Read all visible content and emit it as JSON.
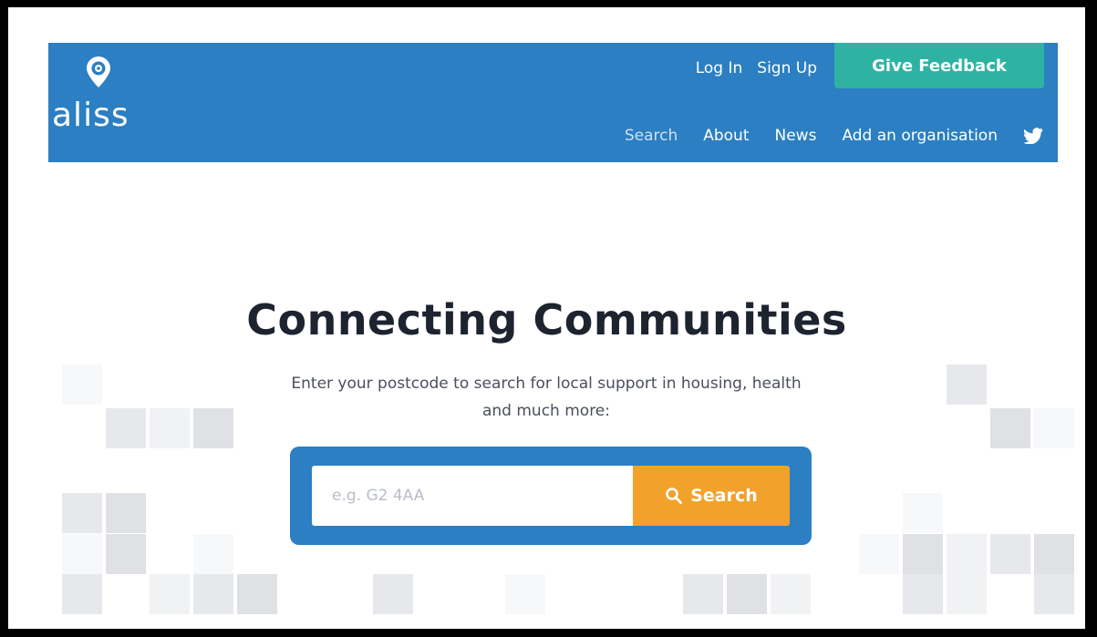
{
  "brand": {
    "name": "aliss"
  },
  "header": {
    "top_links": [
      "Log In",
      "Sign Up"
    ],
    "feedback_label": "Give Feedback",
    "nav": [
      "Search",
      "About",
      "News",
      "Add an organisation"
    ],
    "active_nav": "Search",
    "social_icon": "twitter-icon"
  },
  "hero": {
    "title": "Connecting Communities",
    "subtitle_line1": "Enter your postcode to search for local support in housing, health",
    "subtitle_line2": "and much more:"
  },
  "search": {
    "placeholder": "e.g. G2 4AA",
    "button_label": "Search",
    "button_icon": "search-icon"
  },
  "colors": {
    "primary": "#2b7fc2",
    "feedback": "#2eb3a3",
    "search_button": "#f2a22a",
    "title_text": "#1e2330"
  }
}
